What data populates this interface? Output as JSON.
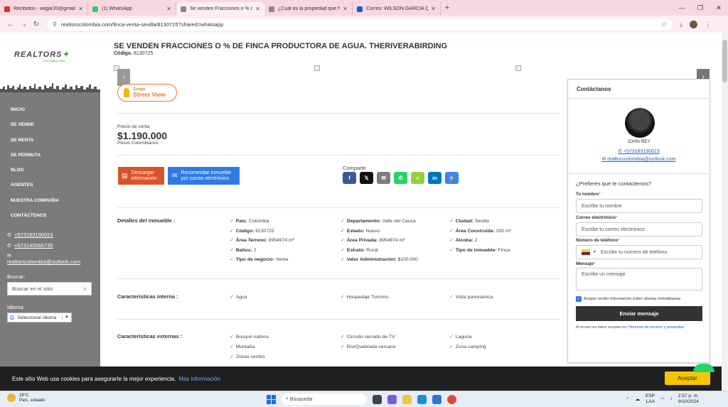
{
  "browser": {
    "tabs": [
      {
        "label": "Recibidos - wilgar20@gmail.com",
        "color": "#d93025"
      },
      {
        "label": "(1) WhatsApp",
        "color": "#25d366"
      },
      {
        "label": "Se venden Fracciones o % de F",
        "color": "#888888"
      },
      {
        "label": "¿Cuál es la propiedad que Nec",
        "color": "#888888"
      },
      {
        "label": "Correo: WILSON GARCIA QUIN",
        "color": "#0a64c8"
      }
    ],
    "url": "realtorscolombia.com/finca-venta-sevilla/8130725?shared=whatsapp"
  },
  "sidebar": {
    "logo_text": "REALTORS",
    "logo_sub": "COLOMBIA.COM",
    "nav": [
      "INICIO",
      "SE VENDE",
      "SE RENTA",
      "SE PERMUTA",
      "BLOG",
      "AGENTES",
      "NUESTRA COMPAÑIA",
      "CONTÁCTENOS"
    ],
    "phone1": "+573183190023",
    "phone2": "+573145565735",
    "email": "realtorscolombia@outlook.com",
    "search_label": "Buscar:",
    "search_placeholder": "Buscar en el sitio",
    "lang_label": "Idioma:",
    "lang_select": "Seleccionar idioma"
  },
  "property": {
    "title": "SE VENDEN FRACCIONES O % DE FINCA PRODUCTORA DE AGUA. THERIVERABIRDING",
    "code_label": "Código.",
    "code": "8130725",
    "streetview_top": "Google",
    "streetview_bottom": "Street View",
    "price_label": "Precio de venta",
    "price": "$1.190.000",
    "currency": "Pesos Colombianos",
    "download_label": "Descargar información",
    "recommend_label": "Recomendar inmueble por correo electrónico",
    "share_label": "Compartir",
    "share_buttons": [
      {
        "icon": "facebook-icon",
        "glyph": "f",
        "color": "#3b5998"
      },
      {
        "icon": "x-icon",
        "glyph": "𝕏",
        "color": "#111111"
      },
      {
        "icon": "email-icon",
        "glyph": "✉",
        "color": "#7d7d7d"
      },
      {
        "icon": "whatsapp-icon",
        "glyph": "✆",
        "color": "#25d366"
      },
      {
        "icon": "sharethis-icon",
        "glyph": "<",
        "color": "#95d03a"
      },
      {
        "icon": "linkedin-icon",
        "glyph": "in",
        "color": "#0077b5"
      },
      {
        "icon": "messenger-icon",
        "glyph": "⚡",
        "color": "#3b82f6"
      }
    ],
    "details_label": "Detalles del inmueble :",
    "details": [
      [
        {
          "k": "País:",
          "v": "Colombia"
        },
        {
          "k": "Departamento:",
          "v": "Valle del Cauca"
        },
        {
          "k": "Ciudad:",
          "v": "Sevilla"
        }
      ],
      [
        {
          "k": "Código:",
          "v": "8130725"
        },
        {
          "k": "Estado:",
          "v": "Nuevo"
        },
        {
          "k": "Área Construida:",
          "v": "200 m²"
        }
      ],
      [
        {
          "k": "Área Terreno:",
          "v": "8954974 m²"
        },
        {
          "k": "Área Privada:",
          "v": "8954974 m²"
        },
        {
          "k": "Alcoba:",
          "v": "2"
        }
      ],
      [
        {
          "k": "Baños:",
          "v": "2"
        },
        {
          "k": "Estrato:",
          "v": "Rural"
        },
        {
          "k": "Tipo de inmueble:",
          "v": "Finca"
        }
      ],
      [
        {
          "k": "Tipo de negocio:",
          "v": "Venta"
        },
        {
          "k": "Valor Administración:",
          "v": "$100.000"
        },
        {
          "k": "",
          "v": ""
        }
      ]
    ],
    "internal_label": "Características interna :",
    "internal": [
      "Agua",
      "Hospedaje Turismo",
      "Vista panorámica"
    ],
    "external_label": "Características externas :",
    "external": [
      [
        "Bosque nativos",
        "Circuito cerrado de TV",
        "Laguna"
      ],
      [
        "Montaña",
        "Río/Quebrada cercano",
        "Zona camping"
      ],
      [
        "Zonas verdes",
        "",
        ""
      ]
    ]
  },
  "contact": {
    "header": "Contáctanos",
    "agent_name": "JOHN REY",
    "agent_phone": "+573183190023",
    "agent_email": "realtorscolombia@outlook.com",
    "prefer": "¿Prefieres que te contactemos?",
    "name_label": "Tu nombre",
    "name_placeholder": "Escribe tu nombre",
    "email_label": "Correo electrónico",
    "email_placeholder": "Escribe tu correo electrónico",
    "phone_label": "Número de teléfono",
    "phone_placeholder": "Escribe tu número de teléfono",
    "msg_label": "Mensaje",
    "msg_placeholder": "Escribe un mensaje",
    "consent": "Acepto recibir información sobre ofertas inmobiliarias",
    "send": "Enviar mensaje",
    "terms_prefix": "Al enviar tus datos aceptas los",
    "terms_link": "Términos de servicio y privacidad"
  },
  "cookie": {
    "text": "Este sitio Web usa cookies para asegurarte la mejor experiencia.",
    "more": "Más información",
    "accept": "Aceptar"
  },
  "taskbar": {
    "temp": "28°C",
    "weather": "Parc. soleado",
    "search": "Búsqueda",
    "lang": "ESP",
    "lang2": "LAA",
    "time": "2:57 p. m.",
    "date": "9/10/2024"
  }
}
